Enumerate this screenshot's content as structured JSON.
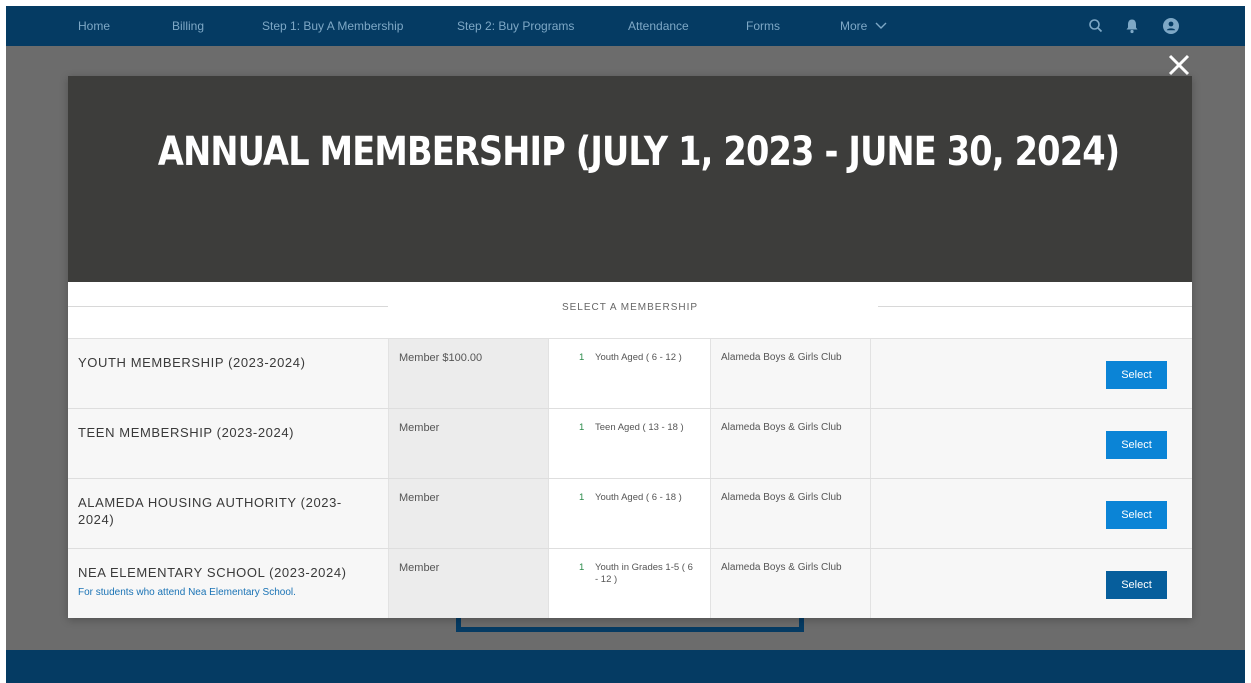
{
  "nav": {
    "items": [
      {
        "label": "Home"
      },
      {
        "label": "Billing"
      },
      {
        "label": "Step 1: Buy A Membership"
      },
      {
        "label": "Step 2: Buy Programs"
      },
      {
        "label": "Attendance"
      },
      {
        "label": "Forms"
      },
      {
        "label": "More"
      }
    ],
    "icons": [
      "search-icon",
      "bell-icon",
      "user-avatar-icon"
    ]
  },
  "modal": {
    "title": "ANNUAL MEMBERSHIP (JULY 1, 2023 - JUNE 30, 2024)",
    "section_title": "SELECT A MEMBERSHIP",
    "close_icon": "close-icon",
    "memberships": [
      {
        "name": "YOUTH MEMBERSHIP (2023-2024)",
        "description": "",
        "price": "Member $100.00",
        "count": "1",
        "age": "Youth Aged ( 6 - 12 )",
        "club": "Alameda Boys & Girls Club",
        "button": "Select"
      },
      {
        "name": "TEEN MEMBERSHIP (2023-2024)",
        "description": "",
        "price": "Member",
        "count": "1",
        "age": "Teen Aged ( 13 - 18 )",
        "club": "Alameda Boys & Girls Club",
        "button": "Select"
      },
      {
        "name": "ALAMEDA HOUSING AUTHORITY (2023-2024)",
        "description": "",
        "price": "Member",
        "count": "1",
        "age": "Youth Aged ( 6 - 18 )",
        "club": "Alameda Boys & Girls Club",
        "button": "Select"
      },
      {
        "name": "NEA ELEMENTARY SCHOOL (2023-2024)",
        "description": "For students who attend Nea Elementary School.",
        "price": "Member",
        "count": "1",
        "age": "Youth in Grades 1-5 ( 6 - 12 )",
        "club": "Alameda Boys & Girls Club",
        "button": "Select"
      }
    ]
  },
  "colors": {
    "nav_bg": "#053b63",
    "banner_bg": "#3d3d3b",
    "button": "#0b84d6",
    "button_active": "#065e9c",
    "link": "#1a73b5"
  }
}
